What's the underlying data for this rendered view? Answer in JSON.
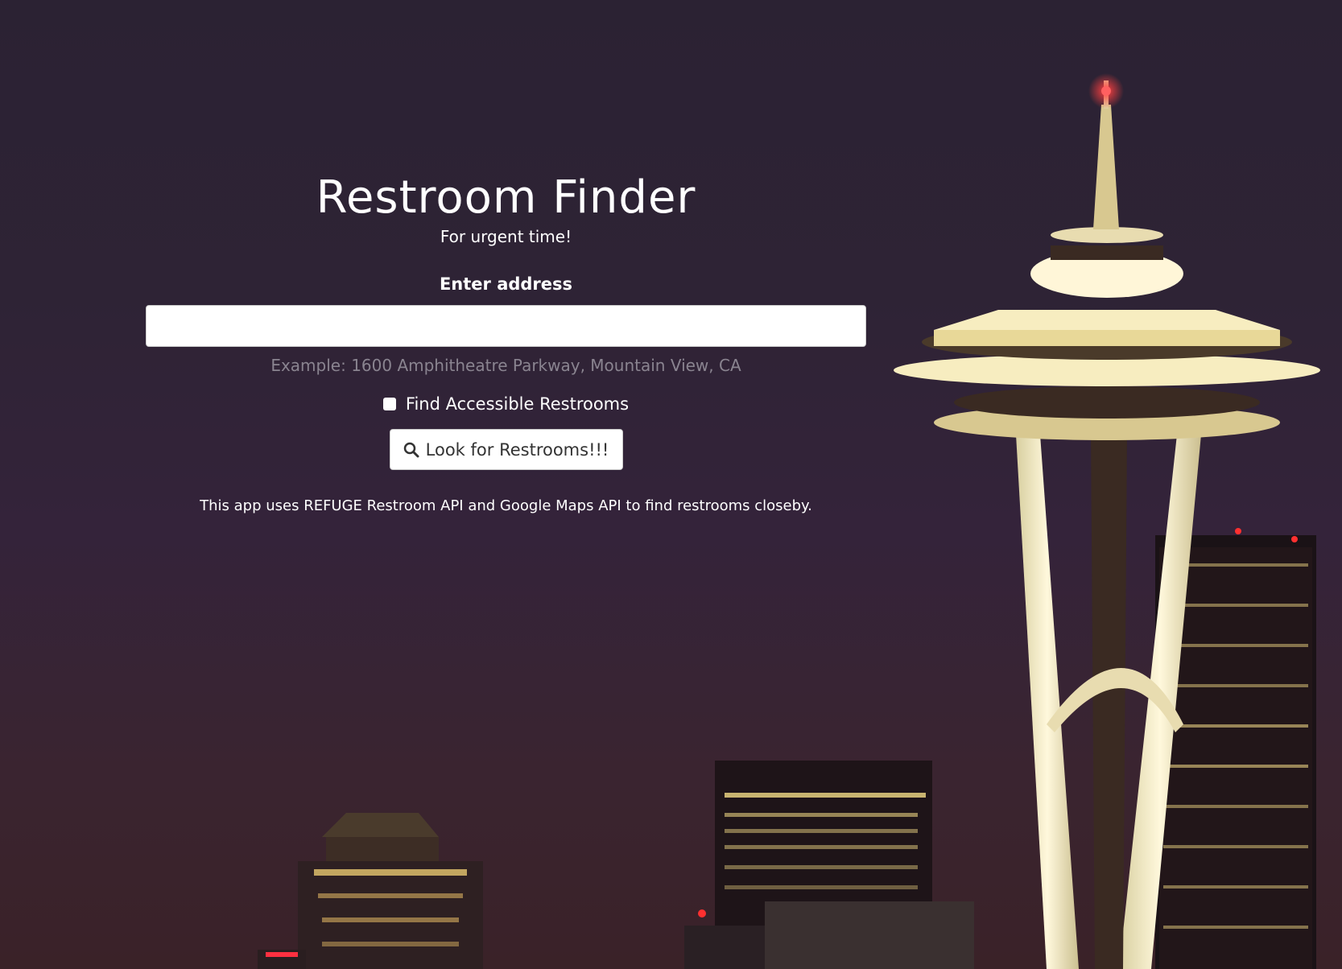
{
  "app": {
    "title": "Restroom Finder",
    "subtitle": "For urgent time!"
  },
  "form": {
    "address_label": "Enter address",
    "address_value": "",
    "address_help": "Example: 1600 Amphitheatre Parkway, Mountain View, CA",
    "accessible_label": "Find Accessible Restrooms",
    "accessible_checked": false,
    "search_button_label": "Look for Restrooms!!!",
    "search_button_icon": "search-icon"
  },
  "footer": {
    "note": "This app uses REFUGE Restroom API and Google Maps API to find restrooms closeby."
  },
  "colors": {
    "sky": "#2e2335",
    "text": "#ffffff",
    "help_text": "#8a8490",
    "tower_light": "#f7edc0",
    "beacon": "#ff3030"
  }
}
